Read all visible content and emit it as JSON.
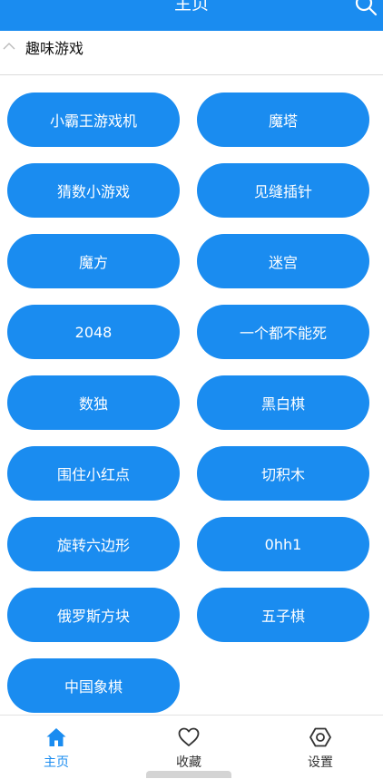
{
  "header": {
    "title": "主页"
  },
  "section": {
    "label": "趣味游戏"
  },
  "games": [
    "小霸王游戏机",
    "魔塔",
    "猜数小游戏",
    "见缝插针",
    "魔方",
    "迷宫",
    "2048",
    "一个都不能死",
    "数独",
    "黑白棋",
    "围住小红点",
    "切积木",
    "旋转六边形",
    "0hh1",
    "俄罗斯方块",
    "五子棋",
    "中国象棋"
  ],
  "tabbar": {
    "items": [
      {
        "label": "主页",
        "icon": "home-icon",
        "active": true
      },
      {
        "label": "收藏",
        "icon": "heart-icon",
        "active": false
      },
      {
        "label": "设置",
        "icon": "settings-icon",
        "active": false
      }
    ]
  },
  "colors": {
    "accent": "#1a8cf0",
    "inactive": "#333333"
  }
}
